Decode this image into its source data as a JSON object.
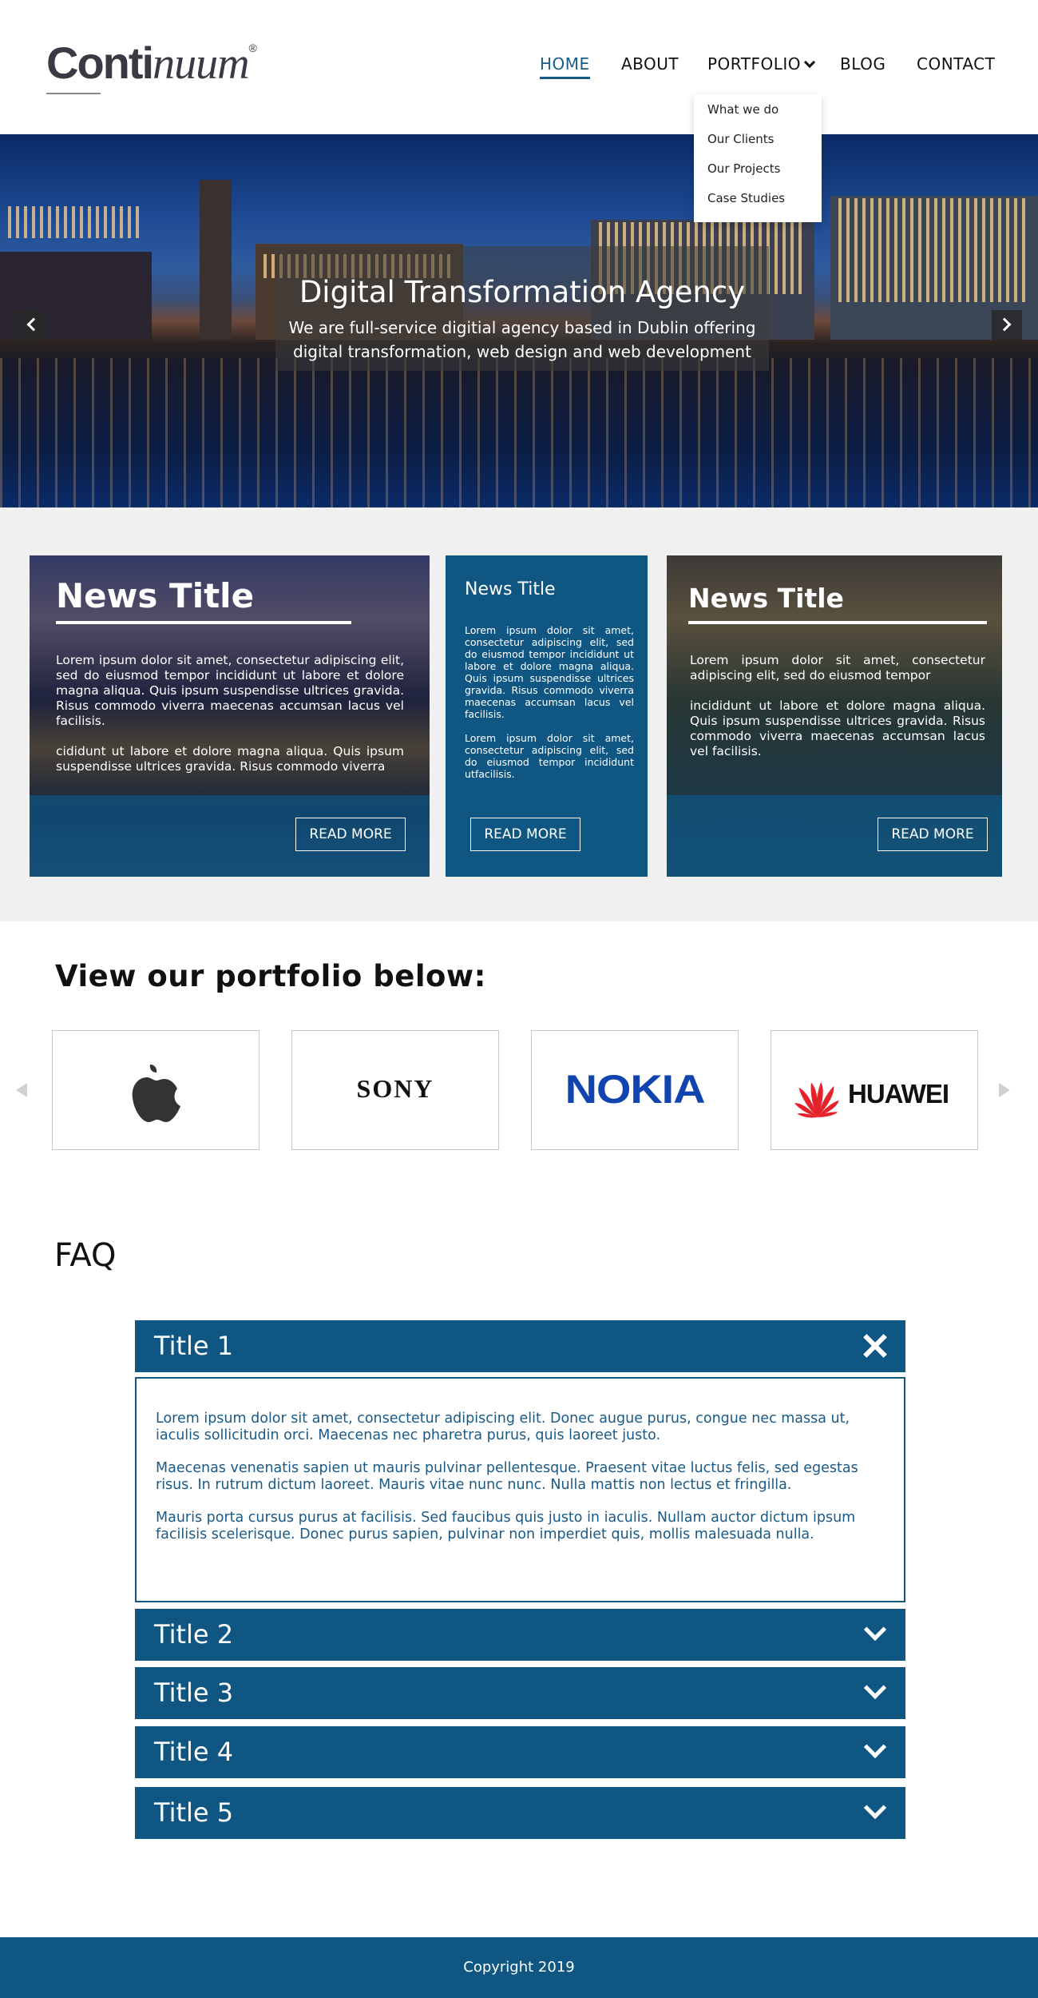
{
  "brand": {
    "logo_main": "Conti",
    "logo_italic": "nuum",
    "registered": "®"
  },
  "nav": {
    "items": [
      {
        "label": "HOME"
      },
      {
        "label": "ABOUT"
      },
      {
        "label": "PORTFOLIO"
      },
      {
        "label": "BLOG"
      },
      {
        "label": "CONTACT"
      }
    ],
    "active": "HOME",
    "dropdown": [
      "What we do",
      "Our Clients",
      "Our Projects",
      "Case Studies"
    ]
  },
  "hero": {
    "title": "Digital Transformation Agency",
    "subtitle_line1": "We are full-service digitial agency based in Dublin offering",
    "subtitle_line2": "digital transformation, web design and web development"
  },
  "news": {
    "card1": {
      "title": "News Title",
      "p1": "Lorem ipsum dolor sit amet, consectetur adipiscing elit, sed do eiusmod tempor incididunt ut labore et dolore magna aliqua. Quis ipsum suspendisse ultrices gravida. Risus commodo viverra maecenas accumsan lacus vel facilisis.",
      "p2": "cididunt ut labore et dolore magna aliqua. Quis ipsum suspendisse ultrices gravida. Risus commodo viverra",
      "button": "READ MORE"
    },
    "card2": {
      "title": "News Title",
      "p1": "Lorem ipsum dolor sit amet, consectetur adipiscing elit, sed do eiusmod tempor incididunt ut labore et dolore magna aliqua. Quis ipsum suspendisse ultrices gravida. Risus commodo viverra maecenas accumsan lacus vel facilisis.",
      "p2": "Lorem ipsum dolor sit amet, consectetur adipiscing elit, sed do eiusmod tempor incididunt utfacilisis.",
      "button": "READ MORE"
    },
    "card3": {
      "title": "News Title",
      "p1": "Lorem ipsum dolor sit amet, consectetur adipiscing elit, sed do eiusmod tempor",
      "p2": "incididunt ut labore et dolore magna aliqua. Quis ipsum suspendisse ultrices gravida. Risus commodo viverra maecenas accumsan lacus vel facilisis.",
      "button": "READ MORE"
    }
  },
  "portfolio": {
    "title": "View our portfolio below:",
    "logos": [
      "apple",
      "SONY",
      "NOKIA",
      "HUAWEI"
    ]
  },
  "faq": {
    "title": "FAQ",
    "items": [
      {
        "label": "Title 1"
      },
      {
        "label": "Title 2"
      },
      {
        "label": "Title 3"
      },
      {
        "label": "Title 4"
      },
      {
        "label": "Title 5"
      }
    ],
    "open_body": [
      "Lorem ipsum dolor sit amet, consectetur adipiscing elit. Donec augue purus, congue nec massa ut, iaculis sollicitudin orci. Maecenas nec pharetra purus, quis laoreet justo.",
      "Maecenas venenatis sapien ut mauris pulvinar pellentesque. Praesent vitae luctus felis, sed egestas risus. In rutrum dictum laoreet. Mauris vitae nunc nunc. Nulla mattis non lectus et fringilla.",
      "Mauris porta cursus purus at facilisis. Sed faucibus quis justo in iaculis. Nullam auctor dictum ipsum facilisis scelerisque. Donec purus sapien, pulvinar non imperdiet quis, mollis malesuada nulla."
    ]
  },
  "footer": {
    "copyright": "Copyright 2019"
  },
  "colors": {
    "primary": "#0f5683",
    "nav_active": "#1a5a87",
    "news_bg": "#f0f0f0"
  }
}
